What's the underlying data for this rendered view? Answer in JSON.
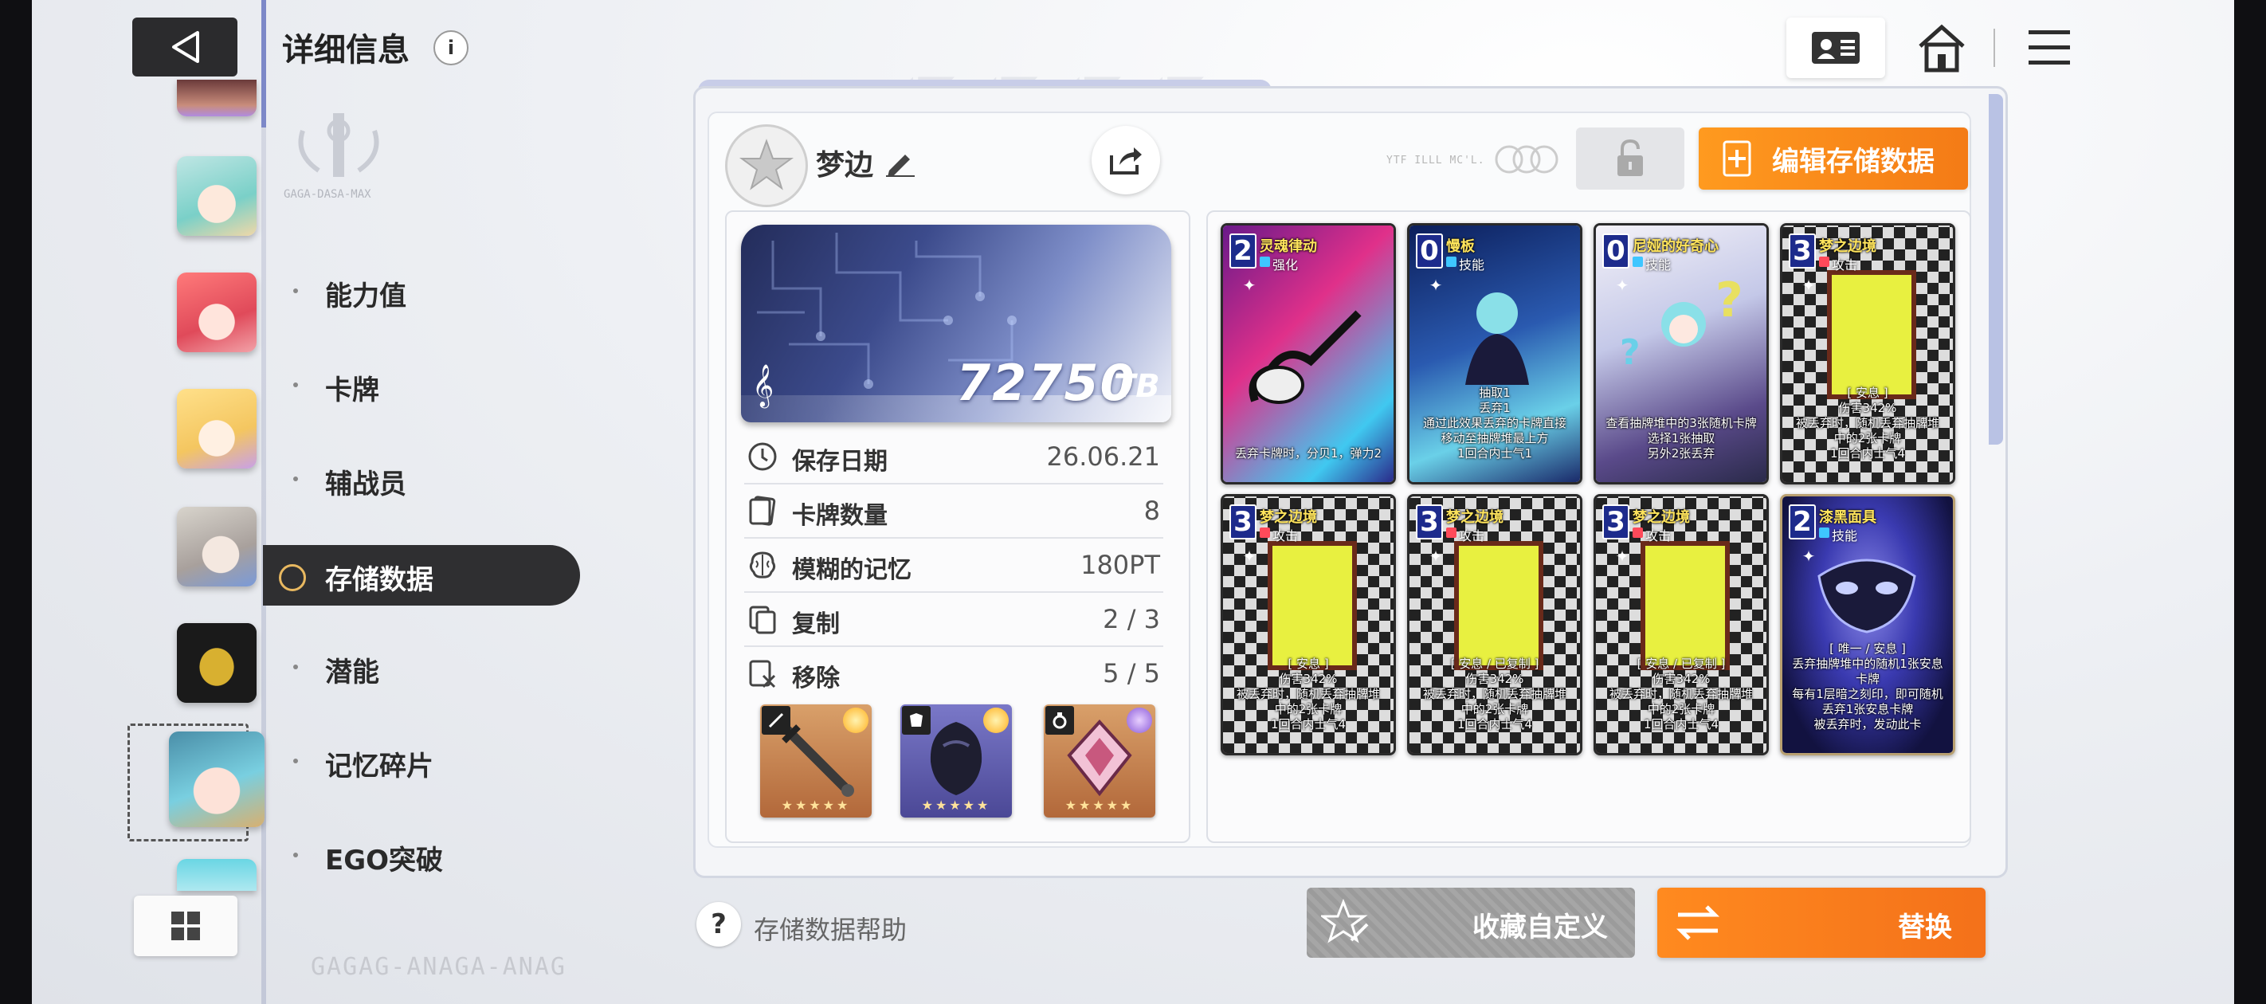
{
  "header": {
    "title": "详细信息",
    "info_icon": "i"
  },
  "nav": {
    "items": [
      {
        "label": "能力值"
      },
      {
        "label": "卡牌"
      },
      {
        "label": "辅战员"
      },
      {
        "label": "存储数据",
        "active": true
      },
      {
        "label": "潜能"
      },
      {
        "label": "记忆碎片"
      },
      {
        "label": "EGO突破"
      }
    ],
    "emblem_caption": "GAGA-DASA-MAX",
    "footer_code": "GAGAG-ANAGA-ANAG"
  },
  "save": {
    "name": "梦边",
    "tb_value": "72750",
    "tb_unit": "TB",
    "micro_text": "YTF ILLL MC'L.",
    "stats": [
      {
        "label": "保存日期",
        "value": "26.06.21",
        "icon": "clock-icon"
      },
      {
        "label": "卡牌数量",
        "value": "8",
        "icon": "card-icon"
      },
      {
        "label": "模糊的记忆",
        "value": "180PT",
        "icon": "brain-icon"
      },
      {
        "label": "复制",
        "value": "2 / 3",
        "icon": "copy-icon"
      },
      {
        "label": "移除",
        "value": "5 / 5",
        "icon": "remove-icon"
      }
    ],
    "equipment": [
      {
        "name": "sword-equipment",
        "stars": "★★★★★",
        "slot_icon": "sword-icon"
      },
      {
        "name": "armor-equipment",
        "stars": "★★★★★",
        "slot_icon": "armor-icon"
      },
      {
        "name": "ring-equipment",
        "stars": "★★★★★",
        "slot_icon": "ring-icon"
      }
    ]
  },
  "buttons": {
    "edit_save": "编辑存储数据",
    "favorite_custom": "收藏自定义",
    "replace": "替换",
    "help": "存储数据帮助"
  },
  "cards": [
    {
      "cost": "2",
      "name": "灵魂律动",
      "type": "强化",
      "desc": "丢弃卡牌时，分贝1，弹力2",
      "type_color": "#3ec6ff"
    },
    {
      "cost": "0",
      "name": "慢板",
      "type": "技能",
      "desc": "抽取1\n丢弃1\n通过此效果丢弃的卡牌直接移动至抽牌堆最上方\n1回合内士气1",
      "type_color": "#3ec6ff"
    },
    {
      "cost": "0",
      "name": "尼娅的好奇心",
      "type": "技能",
      "desc": "查看抽牌堆中的3张随机卡牌\n选择1张抽取\n另外2张丢弃",
      "type_color": "#3ec6ff"
    },
    {
      "cost": "3",
      "name": "梦之边境",
      "type": "攻击",
      "desc": "[ 安息 ]\n伤害342%\n被丢弃时，随机丢弃抽牌堆中的2张卡牌\n1回合内士气4",
      "type_color": "#ff4a5a"
    },
    {
      "cost": "3",
      "name": "梦之边境",
      "type": "攻击",
      "desc": "[ 安息 ]\n伤害342%\n被丢弃时，随机丢弃抽牌堆中的2张卡牌\n1回合内士气4",
      "type_color": "#ff4a5a"
    },
    {
      "cost": "3",
      "name": "梦之边境",
      "type": "攻击",
      "desc": "[ 安息 / 已复制 ]\n伤害342%\n被丢弃时，随机丢弃抽牌堆中的2张卡牌\n1回合内士气4",
      "type_color": "#ff4a5a"
    },
    {
      "cost": "3",
      "name": "梦之边境",
      "type": "攻击",
      "desc": "[ 安息 / 已复制 ]\n伤害342%\n被丢弃时，随机丢弃抽牌堆中的2张卡牌\n1回合内士气4",
      "type_color": "#ff4a5a"
    },
    {
      "cost": "2",
      "name": "漆黑面具",
      "type": "技能",
      "desc": "[ 唯一 / 安息 ]\n丢弃抽牌堆中的随机1张安息卡牌\n每有1层暗之刻印，即可随机丢弃1张安息卡牌\n被丢弃时，发动此卡",
      "type_color": "#3ec6ff"
    }
  ],
  "colors": {
    "accent_orange": "#f47b16",
    "active_nav": "#2f2f31",
    "panel_border": "#d3d7e2"
  }
}
